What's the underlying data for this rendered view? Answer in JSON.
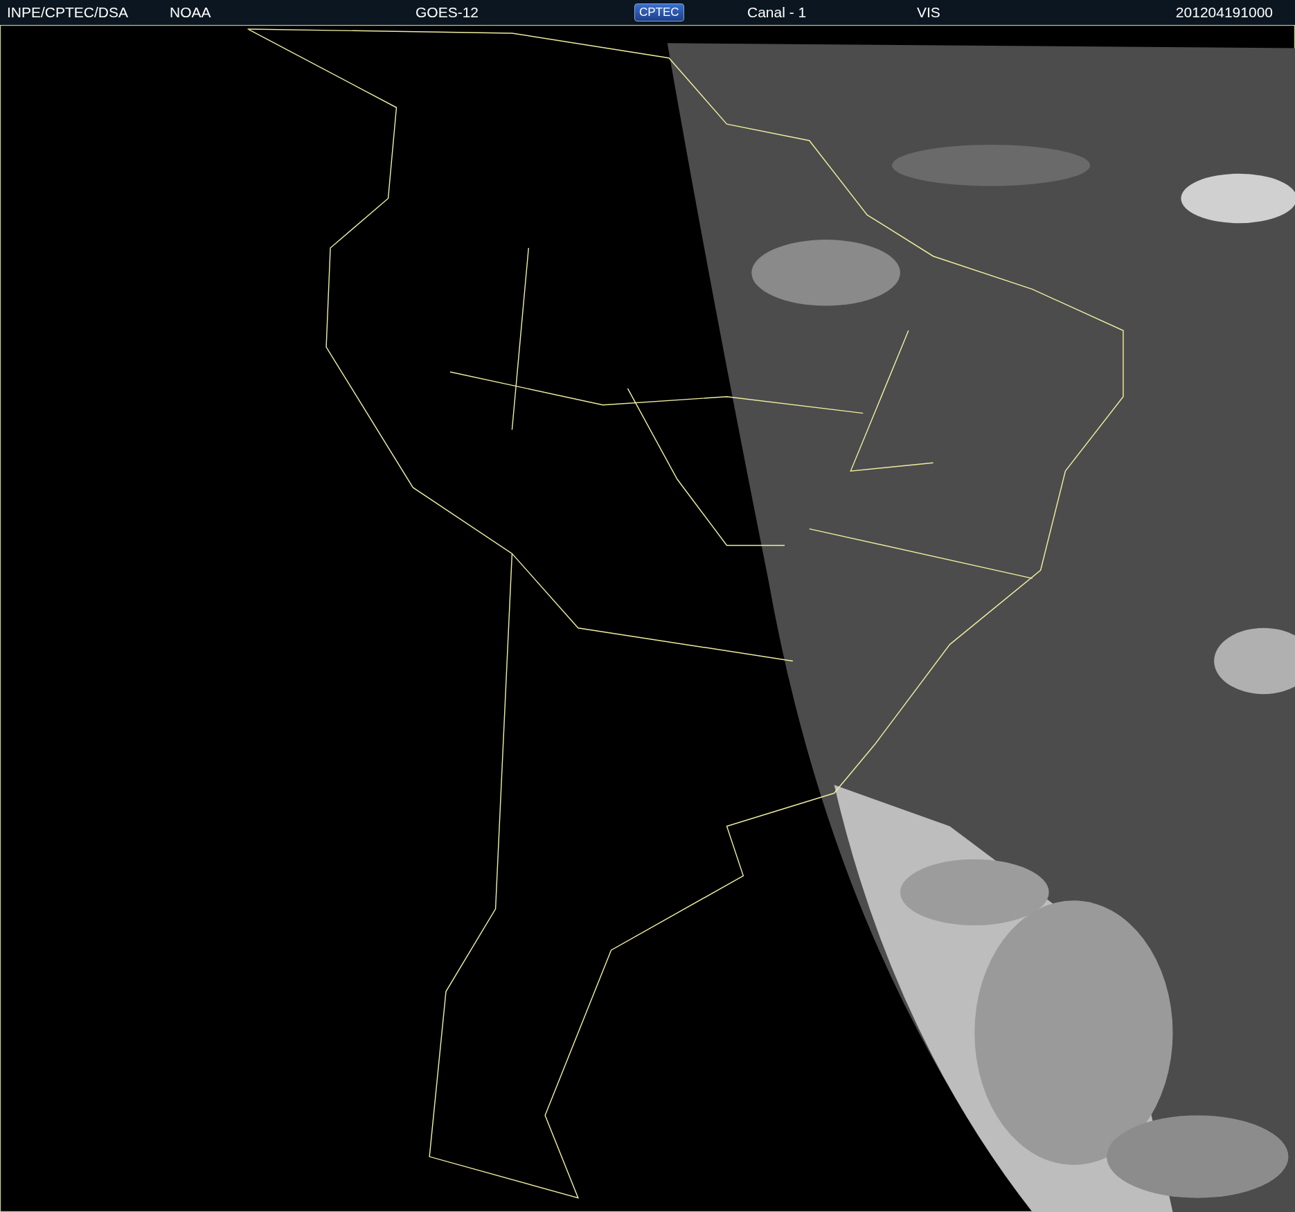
{
  "header": {
    "source": "INPE/CPTEC/DSA",
    "agency": "NOAA",
    "satellite": "GOES-12",
    "logo": "CPTEC",
    "channel": "Canal - 1",
    "band": "VIS",
    "timestamp": "201204191000"
  }
}
